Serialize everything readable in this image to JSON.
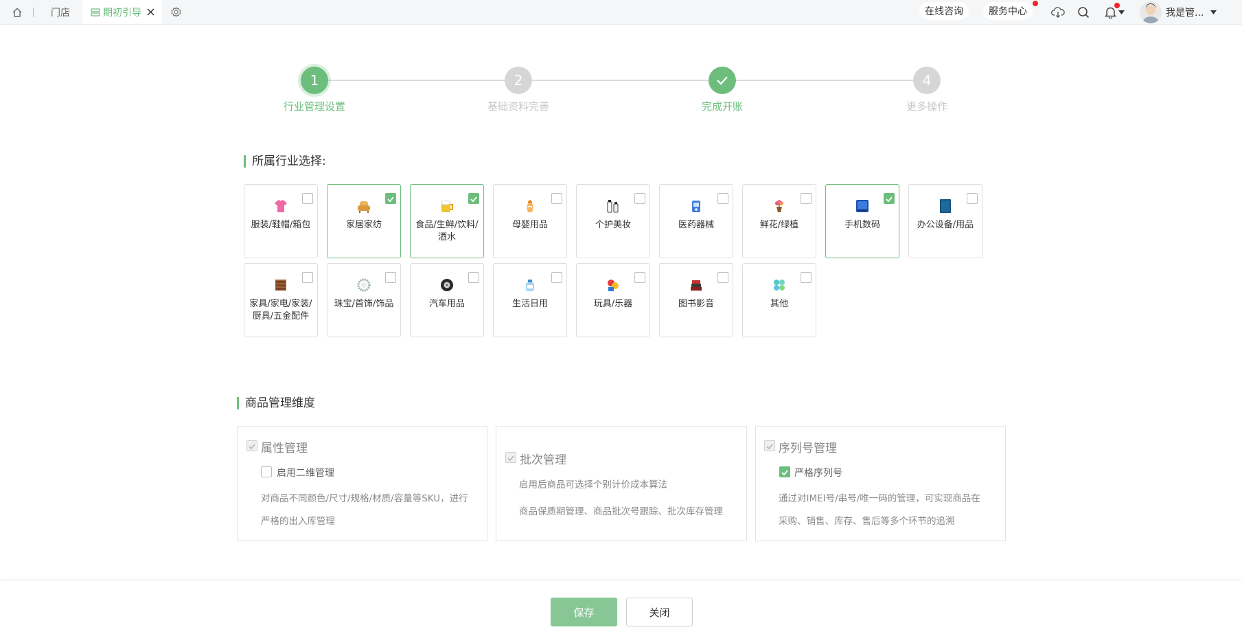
{
  "topbar": {
    "store_tab": "门店",
    "guide_tab": "期初引导",
    "online_consult": "在线咨询",
    "service_center": "服务中心",
    "user_name": "我是管..."
  },
  "steps": [
    {
      "num": "1",
      "label": "行业管理设置",
      "state": "active"
    },
    {
      "num": "2",
      "label": "基础资料完善",
      "state": "todo"
    },
    {
      "num": "",
      "label": "完成开账",
      "state": "done"
    },
    {
      "num": "4",
      "label": "更多操作",
      "state": "todo"
    }
  ],
  "industry": {
    "title": "所属行业选择:",
    "items": [
      {
        "label": "服装/鞋帽/箱包",
        "checked": false,
        "icon": "clothing-icon"
      },
      {
        "label": "家居家纺",
        "checked": true,
        "icon": "sofa-icon"
      },
      {
        "label": "食品/生鲜/饮料/酒水",
        "checked": true,
        "icon": "beer-icon"
      },
      {
        "label": "母婴用品",
        "checked": false,
        "icon": "baby-bottle-icon"
      },
      {
        "label": "个护美妆",
        "checked": false,
        "icon": "cosmetics-icon"
      },
      {
        "label": "医药器械",
        "checked": false,
        "icon": "medicine-icon"
      },
      {
        "label": "鲜花/绿植",
        "checked": false,
        "icon": "flower-icon"
      },
      {
        "label": "手机数码",
        "checked": true,
        "icon": "phone-icon"
      },
      {
        "label": "办公设备/用品",
        "checked": false,
        "icon": "office-icon"
      },
      {
        "label": "家具/家电/家装/厨具/五金配件",
        "checked": false,
        "icon": "cabinet-icon"
      },
      {
        "label": "珠宝/首饰/饰品",
        "checked": false,
        "icon": "jewelry-icon"
      },
      {
        "label": "汽车用品",
        "checked": false,
        "icon": "tire-icon"
      },
      {
        "label": "生活日用",
        "checked": false,
        "icon": "detergent-icon"
      },
      {
        "label": "玩具/乐器",
        "checked": false,
        "icon": "toy-icon"
      },
      {
        "label": "图书影音",
        "checked": false,
        "icon": "books-icon"
      },
      {
        "label": "其他",
        "checked": false,
        "icon": "other-icon"
      }
    ]
  },
  "dimension": {
    "title": "商品管理维度",
    "panels": [
      {
        "title": "属性管理",
        "sub_label": "启用二维管理",
        "sub_checked": false,
        "desc": [
          "对商品不同颜色/尺寸/规格/材质/容量等SKU，进行",
          "严格的出入库管理"
        ]
      },
      {
        "title": "批次管理",
        "sub_label": "",
        "sub_checked": false,
        "desc": [
          "启用后商品可选择个别计价成本算法",
          "商品保质期管理、商品批次号跟踪、批次库存管理"
        ]
      },
      {
        "title": "序列号管理",
        "sub_label": "严格序列号",
        "sub_checked": true,
        "desc": [
          "通过对IMEI号/串号/唯一码的管理，可实现商品在",
          "采购、销售、库存、售后等多个环节的追溯"
        ]
      }
    ]
  },
  "footer": {
    "save": "保存",
    "close": "关闭"
  },
  "colors": {
    "accent": "#6dbe7d",
    "gray": "#d6d6d6",
    "red": "#f5222d"
  }
}
